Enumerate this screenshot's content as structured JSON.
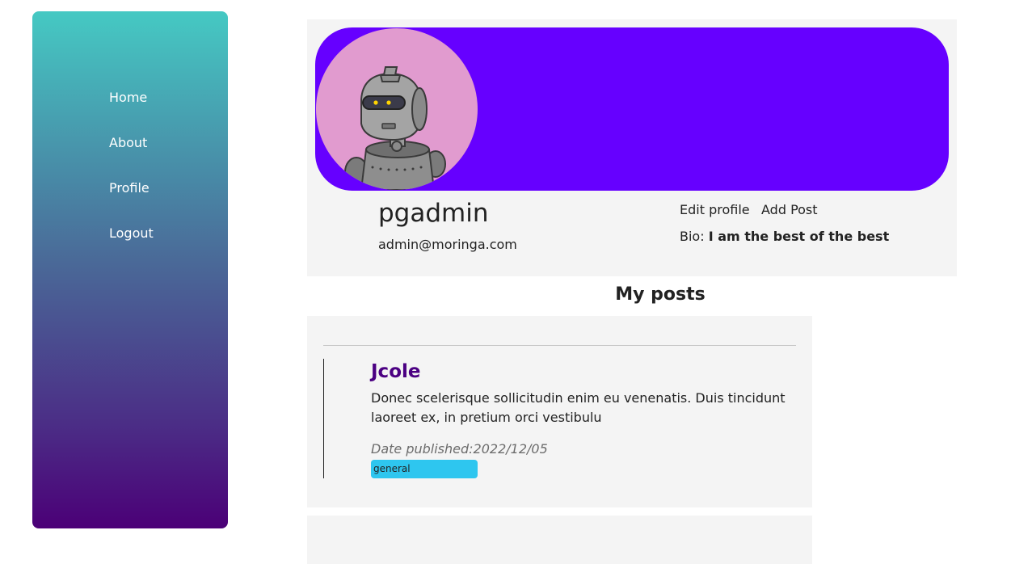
{
  "nav": {
    "items": [
      {
        "label": "Home"
      },
      {
        "label": "About"
      },
      {
        "label": "Profile"
      },
      {
        "label": "Logout"
      }
    ]
  },
  "profile": {
    "username": "pgadmin",
    "email": "admin@moringa.com",
    "actions": {
      "edit_label": "Edit profile",
      "add_post_label": "Add Post"
    },
    "bio_label": "Bio: ",
    "bio_text": "I am the best of the best"
  },
  "posts_section": {
    "title": "My posts"
  },
  "posts": [
    {
      "title": "Jcole",
      "body": "Donec scelerisque sollicitudin enim eu venenatis. Duis tincidunt laoreet ex, in pretium orci vestibulu",
      "date": "Date published:2022/12/05",
      "tag": "general"
    }
  ],
  "colors": {
    "banner": "#6600ff",
    "avatar_bg": "#e19bcf",
    "post_title": "#4b0082",
    "tag_bg": "#2ec6ef",
    "sidebar_top": "#45c9c3",
    "sidebar_bottom": "#4b0077"
  }
}
